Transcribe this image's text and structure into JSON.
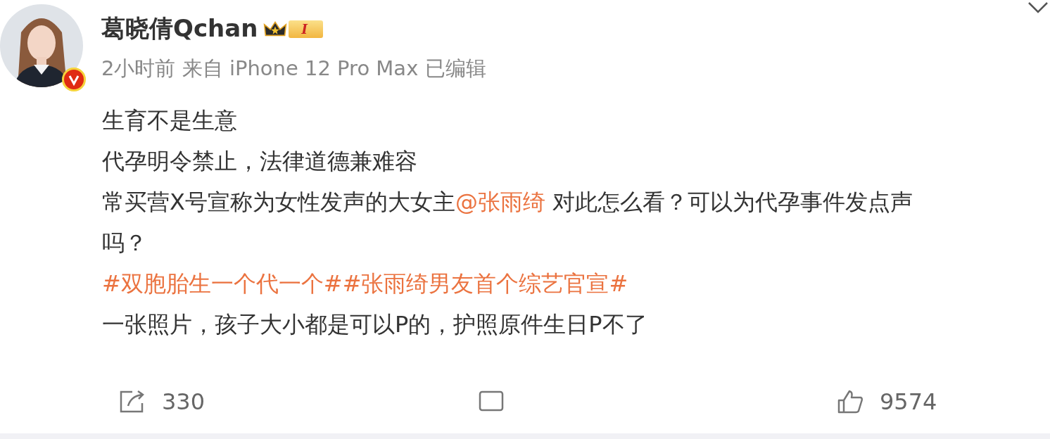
{
  "author": {
    "name": "葛晓倩Qchan",
    "verified": true,
    "member_level": "I"
  },
  "meta": "2小时前 来自 iPhone 12 Pro Max 已编辑",
  "lines": [
    {
      "segments": [
        {
          "kind": "text",
          "text": "生育不是生意"
        }
      ]
    },
    {
      "segments": [
        {
          "kind": "text",
          "text": "代孕明令禁止，法律道德兼难容"
        }
      ]
    },
    {
      "segments": [
        {
          "kind": "text",
          "text": "常买营X号宣称为女性发声的大女主"
        },
        {
          "kind": "mention",
          "text": "@张雨绮"
        },
        {
          "kind": "text",
          "text": " 对此怎么看？可以为代孕事件发点声吗？"
        }
      ]
    },
    {
      "segments": [
        {
          "kind": "hashtag",
          "text": "#双胞胎生一个代一个#"
        },
        {
          "kind": "hashtag",
          "text": "#张雨绮男友首个综艺官宣#"
        }
      ]
    },
    {
      "segments": [
        {
          "kind": "text",
          "text": "一张照片，孩子大小都是可以P的，护照原件生日P不了"
        }
      ]
    }
  ],
  "actions": [
    {
      "kind": "repost",
      "count": "330"
    },
    {
      "kind": "comment"
    },
    {
      "kind": "like",
      "count": "9574"
    }
  ]
}
